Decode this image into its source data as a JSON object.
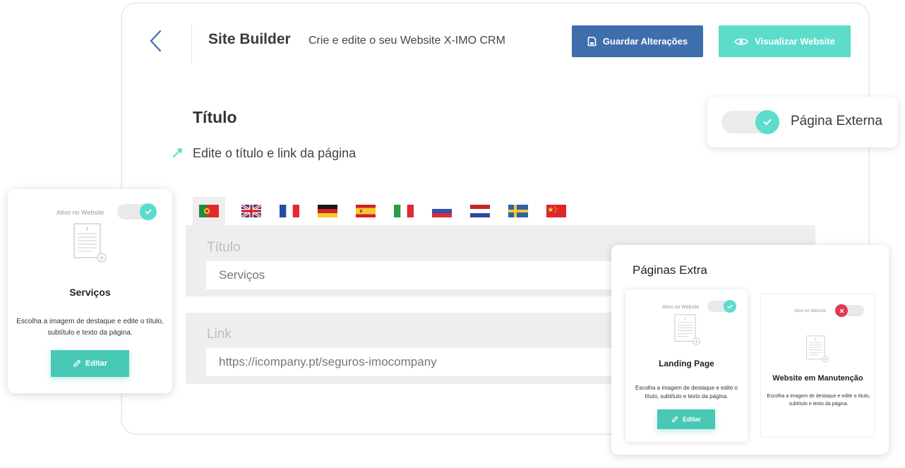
{
  "header": {
    "title": "Site Builder",
    "subtitle": "Crie e edite o seu Website X-IMO CRM",
    "save_label": "Guardar Alterações",
    "view_label": "Visualizar Website"
  },
  "section": {
    "title": "Título",
    "description": "Edite o título e link da página"
  },
  "external_page": {
    "label": "Página Externa",
    "enabled": true
  },
  "languages": [
    "pt",
    "en",
    "fr",
    "de",
    "es",
    "it",
    "ru",
    "nl",
    "sv",
    "zh"
  ],
  "fields": {
    "title_label": "Título",
    "title_value": "Serviços",
    "link_label": "Link",
    "link_value": "https://icompany.pt/seguros-imocompany"
  },
  "services_card": {
    "active_label": "Ativo no Website",
    "doc_number": "1",
    "title": "Serviços",
    "description": "Escolha a imagem de destaque e edite o título, subtítulo e texto da página.",
    "edit_label": "Editar"
  },
  "extra_pages": {
    "heading": "Páginas Extra",
    "cards": [
      {
        "active_label": "Ativo no Website",
        "doc_number": "1",
        "title": "Landing Page",
        "description": "Escolha a imagem de destaque e edite o título, subtítulo e texto da página.",
        "edit_label": "Editar",
        "active": true
      },
      {
        "active_label": "Ativo no Website",
        "doc_number": "1",
        "title": "Website em Manutenção",
        "description": "Escolha a imagem de destaque e edite o título, subtítulo e texto da página.",
        "active": false
      }
    ]
  },
  "colors": {
    "primary": "#3f6ead",
    "accent": "#5ddccb",
    "edit": "#48c9b5",
    "danger": "#e0394e"
  }
}
